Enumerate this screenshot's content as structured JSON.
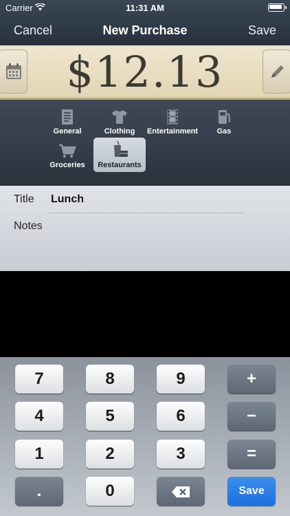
{
  "status_bar": {
    "carrier": "Carrier",
    "time": "11:31 AM"
  },
  "nav": {
    "cancel": "Cancel",
    "title": "New Purchase",
    "save": "Save"
  },
  "amount": {
    "value": "$12.13"
  },
  "categories": {
    "items": [
      {
        "label": "General",
        "icon": "receipt-icon"
      },
      {
        "label": "Clothing",
        "icon": "shirt-icon"
      },
      {
        "label": "Entertainment",
        "icon": "film-icon"
      },
      {
        "label": "Gas",
        "icon": "fuel-pump-icon"
      },
      {
        "label": "Groceries",
        "icon": "cart-icon"
      },
      {
        "label": "Restaurants",
        "icon": "drink-icon"
      }
    ],
    "selected": "Restaurants"
  },
  "form": {
    "title_label": "Title",
    "title_value": "Lunch",
    "notes_label": "Notes"
  },
  "keypad": {
    "row1": [
      "7",
      "8",
      "9",
      "+"
    ],
    "row2": [
      "4",
      "5",
      "6",
      "−"
    ],
    "row3": [
      "1",
      "2",
      "3",
      "="
    ],
    "row4": [
      ".",
      "0",
      "backspace",
      "Save"
    ]
  },
  "colors": {
    "save_key": "#2f80ed",
    "amount_bg": "#ebe1c6",
    "nav_bg": "#323d4a"
  }
}
